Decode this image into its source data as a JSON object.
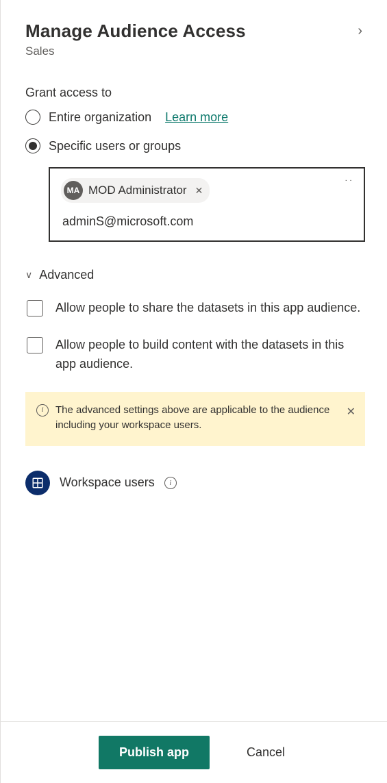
{
  "header": {
    "title": "Manage Audience Access",
    "subtitle": "Sales"
  },
  "grant": {
    "label": "Grant access to",
    "entireOrg": "Entire organization",
    "learnMore": "Learn more",
    "specific": "Specific users or groups"
  },
  "picker": {
    "chipInitials": "MA",
    "chipName": "MOD Administrator",
    "inputValue": "adminS@microsoft.com"
  },
  "advanced": {
    "toggle": "Advanced",
    "allowShare": "Allow people to share the datasets in this app audience.",
    "allowBuild": "Allow people to build content with the datasets in this app audience."
  },
  "banner": {
    "text": "The advanced settings above are applicable to the audience including your workspace users."
  },
  "workspaceUsers": "Workspace users",
  "footer": {
    "publish": "Publish app",
    "cancel": "Cancel"
  }
}
